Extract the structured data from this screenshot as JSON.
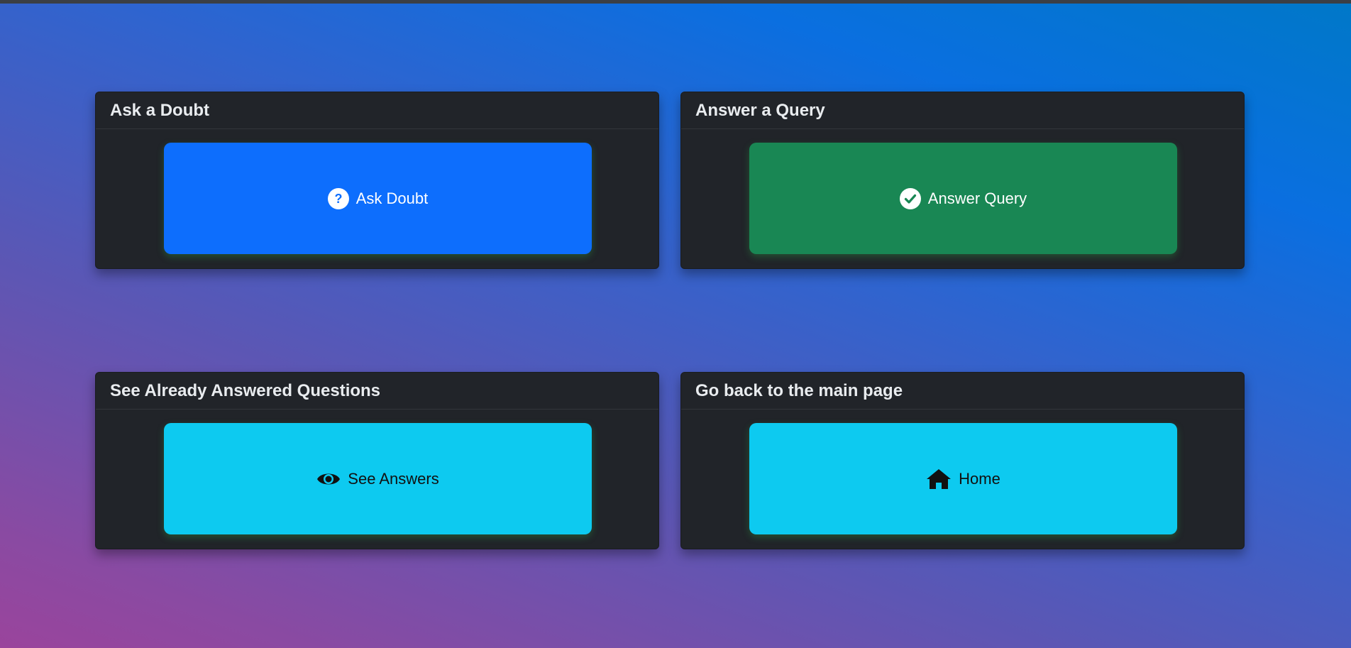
{
  "cards": [
    {
      "title": "Ask a Doubt",
      "button_label": "Ask Doubt",
      "button_icon": "question-circle-icon",
      "button_color": "#0d6efd"
    },
    {
      "title": "Answer a Query",
      "button_label": "Answer Query",
      "button_icon": "check-circle-icon",
      "button_color": "#198754"
    },
    {
      "title": "See Already Answered Questions",
      "button_label": "See Answers",
      "button_icon": "eye-icon",
      "button_color": "#0dcaf0"
    },
    {
      "title": "Go back to the main page",
      "button_label": "Home",
      "button_icon": "home-icon",
      "button_color": "#0dcaf0"
    }
  ],
  "colors": {
    "card_background": "#212429",
    "page_gradient_start": "#0078c8",
    "page_gradient_end": "#9a449c"
  }
}
